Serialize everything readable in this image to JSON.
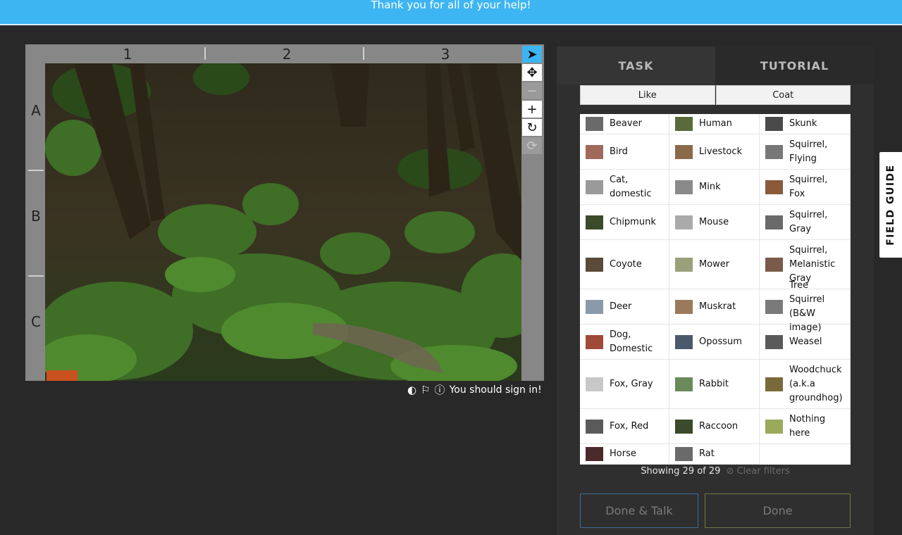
{
  "banner": {
    "text": "Thank you for all of your help!"
  },
  "viewer": {
    "columns": [
      "1",
      "2",
      "3"
    ],
    "rows": [
      "A",
      "B",
      "C"
    ],
    "tools": [
      {
        "name": "pointer-icon",
        "glyph": "➤"
      },
      {
        "name": "move-icon",
        "glyph": "✥"
      },
      {
        "name": "zoom-out-icon",
        "glyph": "−"
      },
      {
        "name": "zoom-in-icon",
        "glyph": "+"
      },
      {
        "name": "rotate-icon",
        "glyph": "↻"
      },
      {
        "name": "reset-icon",
        "glyph": "⟳"
      }
    ],
    "sign_in_text": "You should sign in!"
  },
  "panel": {
    "tabs": [
      "TASK",
      "TUTORIAL"
    ],
    "filters": [
      "Like",
      "Coat"
    ],
    "species": [
      {
        "label": "Beaver",
        "color": "#6a6a6a"
      },
      {
        "label": "Human",
        "color": "#5a6a3a"
      },
      {
        "label": "Skunk",
        "color": "#4a4a4a"
      },
      {
        "label": "Bird",
        "color": "#a06a5a"
      },
      {
        "label": "Livestock",
        "color": "#8a6a4a"
      },
      {
        "label": "Squirrel, Flying",
        "color": "#777777"
      },
      {
        "label": "Cat, domestic",
        "color": "#9a9a9a"
      },
      {
        "label": "Mink",
        "color": "#8a8a8a"
      },
      {
        "label": "Squirrel, Fox",
        "color": "#8a5a3a"
      },
      {
        "label": "Chipmunk",
        "color": "#3a4a2a"
      },
      {
        "label": "Mouse",
        "color": "#aaaaaa"
      },
      {
        "label": "Squirrel, Gray",
        "color": "#6a6a6a"
      },
      {
        "label": "Coyote",
        "color": "#5a4a3a"
      },
      {
        "label": "Mower",
        "color": "#9aa07a"
      },
      {
        "label": "Squirrel, Melanistic Gray",
        "color": "#7a5a4a"
      },
      {
        "label": "Deer",
        "color": "#8a9aaa"
      },
      {
        "label": "Muskrat",
        "color": "#9a7a5a"
      },
      {
        "label": "Tree Squirrel (B&W image)",
        "color": "#7a7a7a"
      },
      {
        "label": "Dog, Domestic",
        "color": "#a04a3a"
      },
      {
        "label": "Opossum",
        "color": "#4a5a6a"
      },
      {
        "label": "Weasel",
        "color": "#5a5a5a"
      },
      {
        "label": "Fox, Gray",
        "color": "#c8c8c8"
      },
      {
        "label": "Rabbit",
        "color": "#6a8a5a"
      },
      {
        "label": "Woodchuck (a.k.a groundhog)",
        "color": "#7a6a3a"
      },
      {
        "label": "Fox, Red",
        "color": "#5a5a5a"
      },
      {
        "label": "Raccoon",
        "color": "#3a4a2a"
      },
      {
        "label": "Nothing here",
        "color": "#9aaa5a"
      },
      {
        "label": "Horse",
        "color": "#4a2a2a"
      },
      {
        "label": "Rat",
        "color": "#6a6a6a"
      }
    ],
    "showing": "Showing 29 of 29",
    "clear_filters": "Clear filters",
    "done_talk": "Done & Talk",
    "done": "Done"
  },
  "field_guide": "FIELD GUIDE"
}
